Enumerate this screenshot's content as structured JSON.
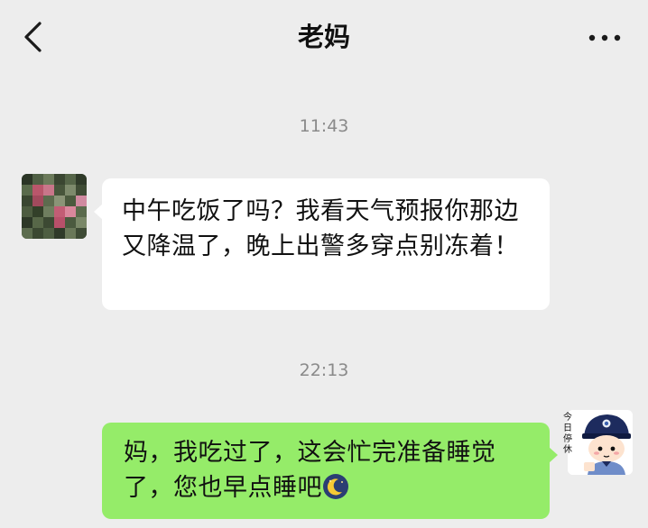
{
  "header": {
    "title": "老妈",
    "back_icon": "chevron-left-icon",
    "more_icon": "more-dots-icon"
  },
  "messages": [
    {
      "time": "11:43",
      "sender": "contact",
      "text": "中午吃饭了吗？我看天气预报你那边又降温了，晚上出警多穿点别冻着！"
    },
    {
      "time": "22:13",
      "sender": "me",
      "text": "妈，我吃过了，这会忙完准备睡觉了，您也早点睡吧",
      "emoji": "moon-sleep-emoji"
    }
  ],
  "me_avatar": {
    "sticker_text": "今日停休"
  },
  "colors": {
    "background": "#ededed",
    "incoming_bubble": "#ffffff",
    "outgoing_bubble": "#95ec69",
    "timestamp": "#8a8a8a"
  }
}
